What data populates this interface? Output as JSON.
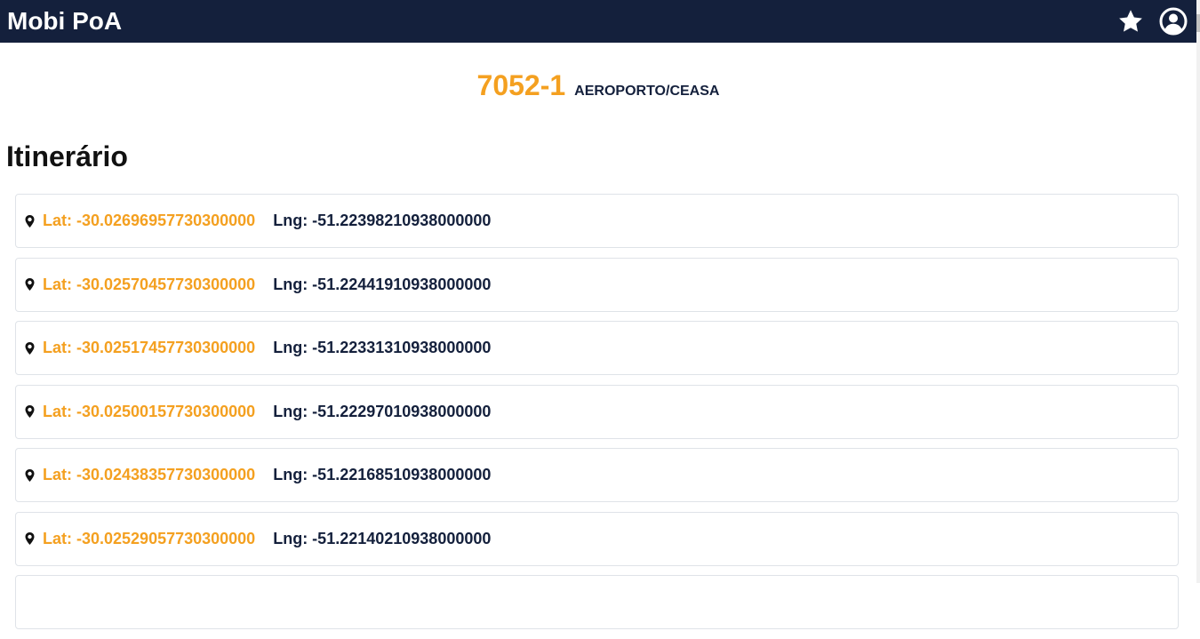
{
  "app": {
    "title": "Mobi PoA",
    "icons": [
      "star-icon",
      "user-circle-icon"
    ]
  },
  "route": {
    "code": "7052-1",
    "name": "AEROPORTO/CEASA"
  },
  "itinerary": {
    "title": "Itinerário",
    "items": [
      {
        "lat": "Lat: -30.02696957730300000",
        "lng": "Lng: -51.22398210938000000"
      },
      {
        "lat": "Lat: -30.02570457730300000",
        "lng": "Lng: -51.22441910938000000"
      },
      {
        "lat": "Lat: -30.02517457730300000",
        "lng": "Lng: -51.22331310938000000"
      },
      {
        "lat": "Lat: -30.02500157730300000",
        "lng": "Lng: -51.22297010938000000"
      },
      {
        "lat": "Lat: -30.02438357730300000",
        "lng": "Lng: -51.22168510938000000"
      },
      {
        "lat": "Lat: -30.02529057730300000",
        "lng": "Lng: -51.22140210938000000"
      },
      {
        "lat": "",
        "lng": ""
      }
    ]
  },
  "colors": {
    "navbar": "#14203c",
    "accent": "#f4a020",
    "text_dark": "#14203c"
  }
}
